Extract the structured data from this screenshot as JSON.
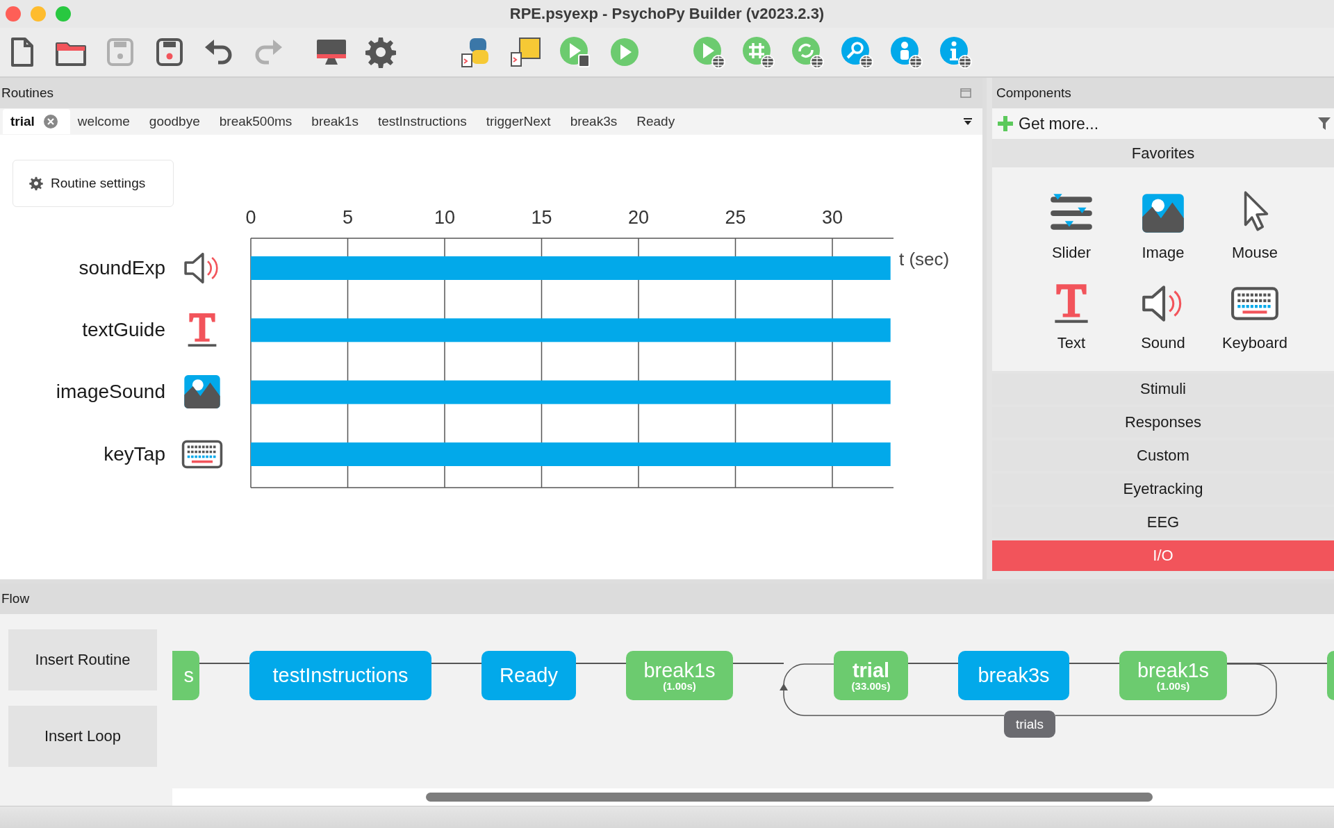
{
  "window": {
    "title": "RPE.psyexp - PsychoPy Builder (v2023.2.3)"
  },
  "toolbar": {
    "groups": [
      {
        "buttons": [
          {
            "kind": "new",
            "disabled": false
          },
          {
            "kind": "open",
            "disabled": false
          },
          {
            "kind": "save",
            "disabled": true
          },
          {
            "kind": "save_as",
            "disabled": false
          },
          {
            "kind": "undo",
            "disabled": false
          },
          {
            "kind": "redo",
            "disabled": true
          }
        ]
      },
      {
        "buttons": [
          {
            "kind": "monitor",
            "disabled": false
          },
          {
            "kind": "settings",
            "disabled": false
          }
        ]
      },
      {
        "buttons": [
          {
            "kind": "python",
            "disabled": false
          },
          {
            "kind": "js",
            "disabled": false
          },
          {
            "kind": "runner",
            "disabled": false
          },
          {
            "kind": "run",
            "disabled": false
          }
        ]
      },
      {
        "buttons": [
          {
            "kind": "run_online",
            "disabled": false
          },
          {
            "kind": "compile_online",
            "disabled": false
          },
          {
            "kind": "sync_online",
            "disabled": false
          },
          {
            "kind": "search_online",
            "disabled": false
          },
          {
            "kind": "user_online",
            "disabled": false
          },
          {
            "kind": "info_online",
            "disabled": false
          }
        ]
      }
    ]
  },
  "routines": {
    "title": "Routines",
    "tabs": [
      {
        "label": "trial",
        "selected": true
      },
      {
        "label": "welcome",
        "selected": false
      },
      {
        "label": "goodbye",
        "selected": false
      },
      {
        "label": "break500ms",
        "selected": false
      },
      {
        "label": "break1s",
        "selected": false
      },
      {
        "label": "testInstructions",
        "selected": false
      },
      {
        "label": "triggerNext",
        "selected": false
      },
      {
        "label": "break3s",
        "selected": false
      },
      {
        "label": "Ready",
        "selected": false
      }
    ],
    "settings_button": "Routine settings",
    "timeline": {
      "components": [
        {
          "name": "soundExp",
          "kind": "sound"
        },
        {
          "name": "textGuide",
          "kind": "text"
        },
        {
          "name": "imageSound",
          "kind": "image"
        },
        {
          "name": "keyTap",
          "kind": "keyboard"
        }
      ],
      "chart_data": {
        "type": "bar",
        "orientation": "horizontal",
        "grid": true,
        "xlabel": "t (sec)",
        "values": [
          33,
          33,
          33,
          33
        ],
        "xlim": [
          0,
          33
        ],
        "xticks": [
          0,
          5,
          10,
          15,
          20,
          25,
          30
        ]
      }
    }
  },
  "components": {
    "title": "Components",
    "get_more": "Get more...",
    "categories": [
      {
        "label": "Favorites",
        "selected": false,
        "items": [
          {
            "label": "Slider",
            "kind": "slider"
          },
          {
            "label": "Image",
            "kind": "image"
          },
          {
            "label": "Mouse",
            "kind": "mouse"
          },
          {
            "label": "Text",
            "kind": "text"
          },
          {
            "label": "Sound",
            "kind": "sound"
          },
          {
            "label": "Keyboard",
            "kind": "keyboard"
          }
        ]
      },
      {
        "label": "Stimuli",
        "selected": false
      },
      {
        "label": "Responses",
        "selected": false
      },
      {
        "label": "Custom",
        "selected": false
      },
      {
        "label": "Eyetracking",
        "selected": false
      },
      {
        "label": "EEG",
        "selected": false
      },
      {
        "label": "I/O",
        "selected": true
      }
    ]
  },
  "flow": {
    "title": "Flow",
    "buttons": [
      "Insert Routine",
      "Insert Loop"
    ],
    "nodes": [
      {
        "label": "s",
        "color": "#6ccb6f"
      },
      {
        "label": "testInstructions",
        "color": "#02a9ea"
      },
      {
        "label": "Ready",
        "color": "#02a9ea"
      },
      {
        "label": "break1s",
        "duration": "(1.00s)",
        "color": "#6ccb6f"
      },
      {
        "label": "trial",
        "duration": "(33.00s)",
        "color": "#6ccb6f"
      },
      {
        "label": "break3s",
        "color": "#02a9ea"
      },
      {
        "label": "break1s",
        "duration": "(1.00s)",
        "color": "#6ccb6f"
      },
      {
        "color": "#6ccb6f"
      }
    ],
    "loops": [
      {
        "label": "trials"
      }
    ]
  }
}
